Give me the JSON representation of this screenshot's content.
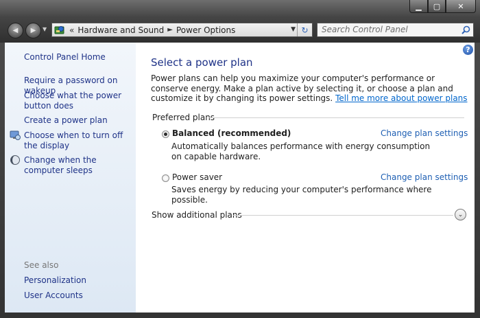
{
  "window": {
    "caption_min": "▁",
    "caption_max": "▢",
    "caption_close": "✕"
  },
  "nav": {
    "back_icon": "back-arrow-icon",
    "forward_icon": "forward-arrow-icon",
    "back_glyph": "◀",
    "forward_glyph": "▶"
  },
  "address": {
    "overflow": "«",
    "crumbs": [
      "Hardware and Sound",
      "Power Options"
    ],
    "separator": "►",
    "drop_glyph": "▼",
    "refresh_glyph": "↻"
  },
  "search": {
    "placeholder": "Search Control Panel"
  },
  "sidebar": {
    "home": "Control Panel Home",
    "items": [
      {
        "label": "Require a password on wakeup"
      },
      {
        "label": "Choose what the power button does"
      },
      {
        "label": "Create a power plan"
      },
      {
        "label": "Choose when to turn off the display",
        "icon": "monitor-icon"
      },
      {
        "label": "Change when the computer sleeps",
        "icon": "moon-icon"
      }
    ],
    "see_also": "See also",
    "see_also_items": [
      "Personalization",
      "User Accounts"
    ]
  },
  "main": {
    "help_glyph": "?",
    "title": "Select a power plan",
    "intro": "Power plans can help you maximize your computer's performance or conserve energy. Make a plan active by selecting it, or choose a plan and customize it by changing its power settings.",
    "intro_link": "Tell me more about power plans",
    "group_label": "Preferred plans",
    "plans": [
      {
        "name": "Balanced (recommended)",
        "selected": true,
        "description": "Automatically balances performance with energy consumption on capable hardware.",
        "change_link": "Change plan settings"
      },
      {
        "name": "Power saver",
        "selected": false,
        "description": "Saves energy by reducing your computer's performance where possible.",
        "change_link": "Change plan settings"
      }
    ],
    "additional": "Show additional plans",
    "expand_glyph": "⌄"
  },
  "colors": {
    "link": "#1e3287",
    "accent_link": "#1e5fb3",
    "sidebar_bg": "#e3ecf6"
  }
}
